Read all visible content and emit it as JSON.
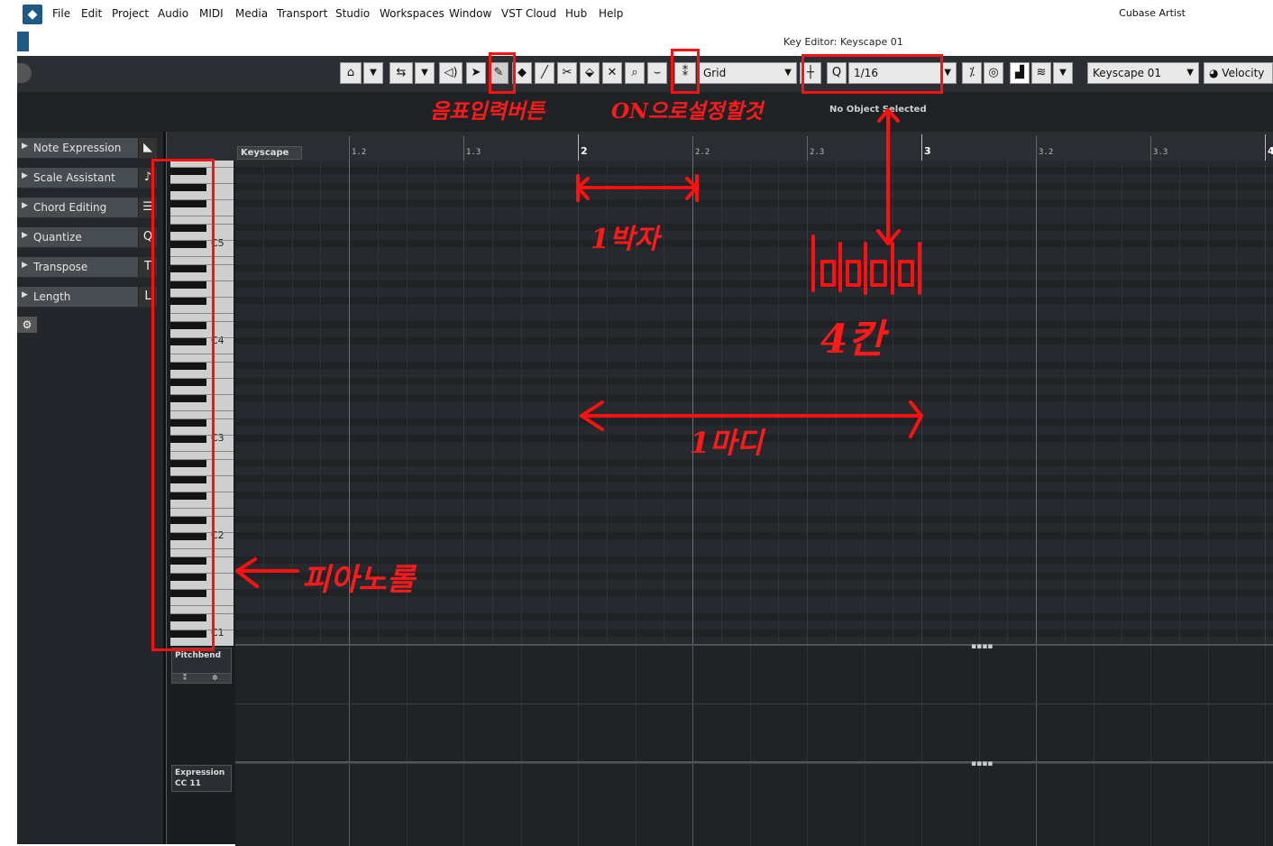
{
  "menu": {
    "items": [
      "File",
      "Edit",
      "Project",
      "Audio",
      "MIDI",
      "Media",
      "Transport",
      "Studio",
      "Workspaces",
      "Window",
      "VST Cloud",
      "Hub",
      "Help"
    ],
    "app_name": "Cubase Artist"
  },
  "window": {
    "title": "Key Editor: Keyscape 01"
  },
  "toolbar": {
    "snap_type": "Grid",
    "quantize_value": "1/16",
    "track_select": "Keyscape 01",
    "lane_display": "Velocity"
  },
  "infoline": {
    "status": "No Object Selected"
  },
  "inspector": {
    "sections": [
      {
        "label": "Note Expression",
        "icon": "note-expression-icon",
        "glyph": "◣"
      },
      {
        "label": "Scale Assistant",
        "icon": "scale-assistant-icon",
        "glyph": "♪"
      },
      {
        "label": "Chord Editing",
        "icon": "chord-editing-icon",
        "glyph": "☰"
      },
      {
        "label": "Quantize",
        "icon": "quantize-icon",
        "glyph": "Q"
      },
      {
        "label": "Transpose",
        "icon": "transpose-icon",
        "glyph": "T"
      },
      {
        "label": "Length",
        "icon": "length-icon",
        "glyph": "L"
      }
    ]
  },
  "ruler": {
    "track_label": "Keyscape 01",
    "labels": [
      "1.2",
      "1.3",
      "2",
      "2.2",
      "2.3",
      "3",
      "3.2",
      "3.3",
      "4"
    ]
  },
  "piano": {
    "octave_labels": [
      "C5",
      "C4",
      "C3",
      "C2",
      "C1"
    ]
  },
  "lanes": [
    {
      "label": "Pitchbend"
    },
    {
      "label": "Expression\nCC 11"
    }
  ],
  "annotations": {
    "note_input_button": "음표입력버튼",
    "snap_on": "ON으로설정할것",
    "one_beat": "1박자",
    "four_cells": "4칸",
    "one_bar": "1마디",
    "piano_roll": "피아노롤"
  },
  "colors": {
    "annotation_red": "#ff1010",
    "toolbar_bg": "#2b2f33",
    "grid_bg": "#26292d"
  }
}
